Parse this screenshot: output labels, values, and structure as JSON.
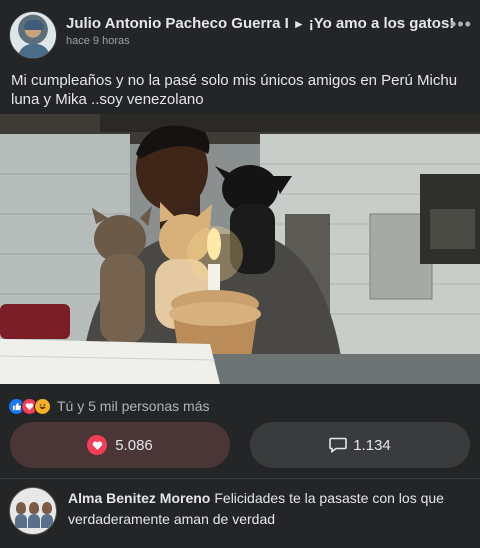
{
  "post": {
    "author": "Julio Antonio Pacheco Guerra I",
    "arrow": "►",
    "group": "¡Yo amo a los gatos!",
    "timestamp": "hace 9 horas",
    "more_label": "•••",
    "text": "Mi cumpleaños y no la pasé solo mis únicos amigos en Perú Michu luna y Mika ..soy venezolano"
  },
  "reactions": {
    "icons": [
      "like-icon",
      "love-icon",
      "haha-icon"
    ],
    "summary": "Tú y 5 mil personas más"
  },
  "actions": {
    "love_count": "5.086",
    "comment_count": "1.134"
  },
  "comment": {
    "author": "Alma Benitez Moreno",
    "text": "Felicidades te la pasaste con los que verdaderamente aman de verdad"
  },
  "colors": {
    "background": "#242526",
    "love": "#f33e58",
    "like": "#1877f2",
    "text": "#e4e6eb",
    "muted": "#b0b3b8"
  }
}
